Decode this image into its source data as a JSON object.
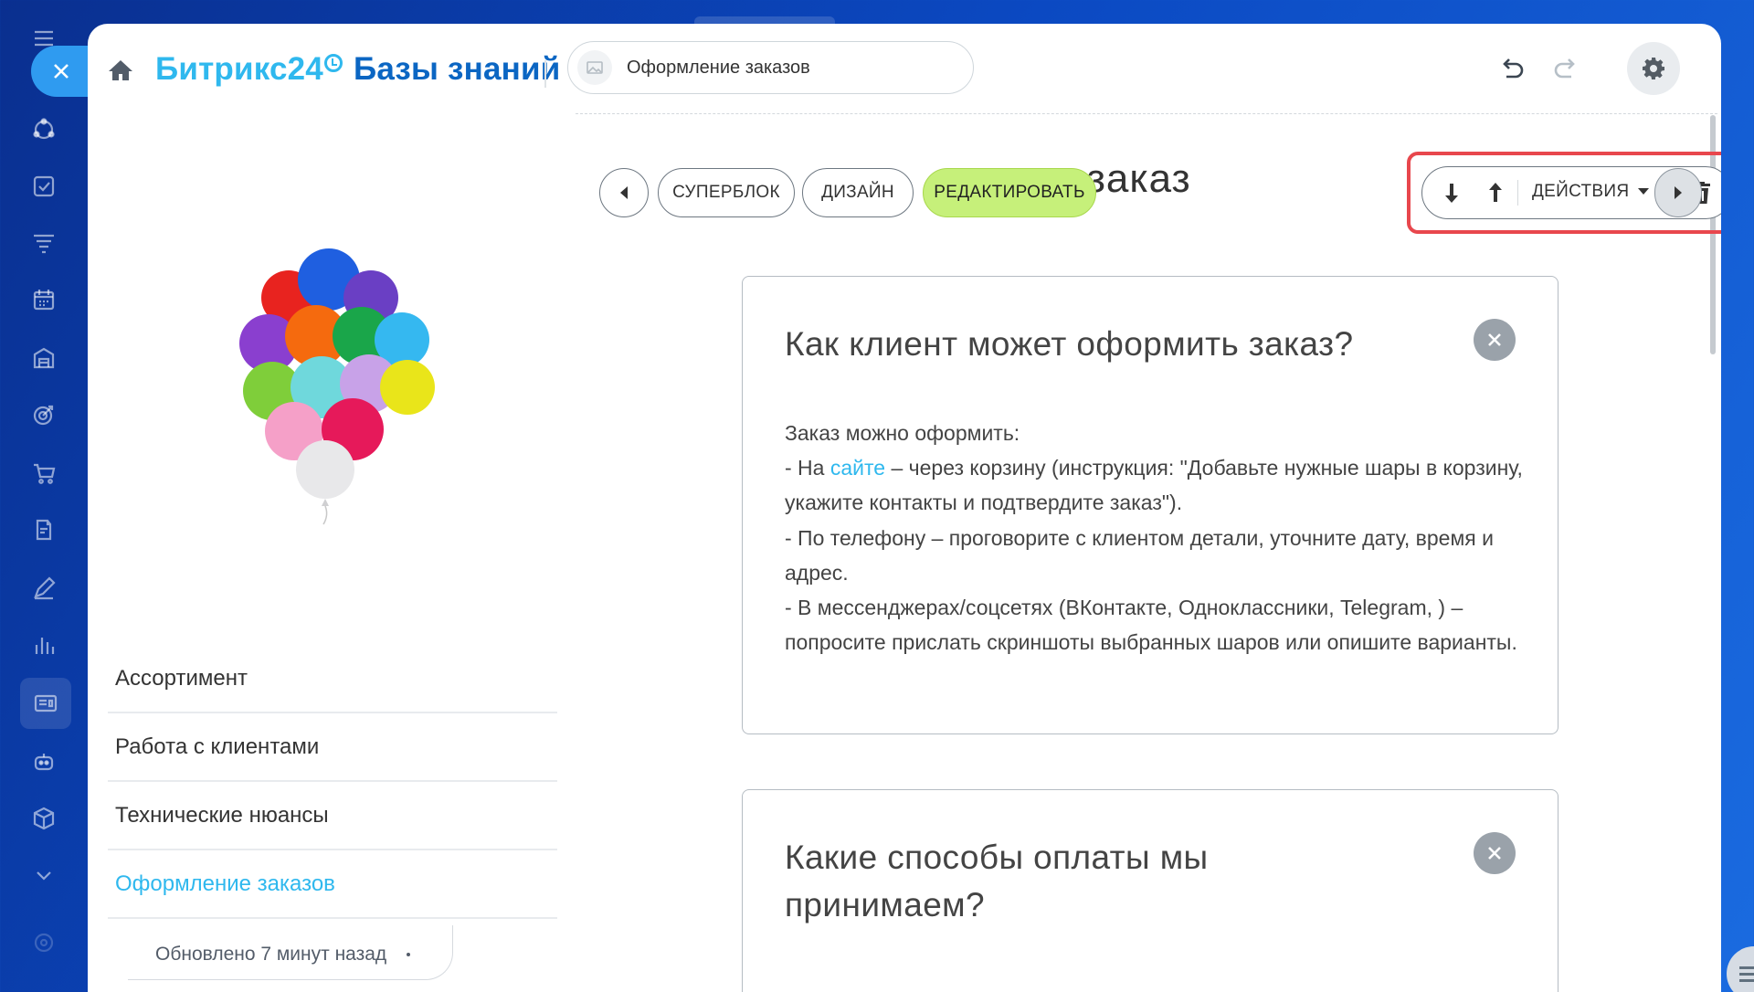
{
  "app": {
    "logo_brand": "Битрикс24",
    "logo_section": "Базы знаний",
    "current_page_chip": "Оформление заказов",
    "accent_color": "#2fb8ee",
    "edit_button_color": "#c6f07a",
    "highlight_color": "#e8474d"
  },
  "rail": {
    "icons": [
      "menu-icon",
      "close-icon",
      "feed-icon",
      "tasks-icon",
      "funnel-icon",
      "calendar-icon",
      "storage-icon",
      "target-icon",
      "cart-icon",
      "document-edit-icon",
      "pen-icon",
      "analytics-icon",
      "sites-icon",
      "robot-icon",
      "box-icon",
      "chevron-down-icon",
      "settings-icon"
    ]
  },
  "toolbar": {
    "prev": "previous-block-icon",
    "superblock": "СУПЕРБЛОК",
    "design": "ДИЗАЙН",
    "edit": "РЕДАКТИРОВАТЬ",
    "actions": "ДЕЙСТВИЯ",
    "next": "next-block-icon"
  },
  "page": {
    "heading_visible_part": "ление заказ"
  },
  "nav": {
    "items": [
      {
        "label": "Ассортимент"
      },
      {
        "label": "Работа с клиентами"
      },
      {
        "label": "Технические нюансы"
      },
      {
        "label": "Оформление заказов"
      }
    ],
    "active_index": 3,
    "updated": "Обновлено 7 минут назад"
  },
  "cards": [
    {
      "title": "Как клиент может оформить заказ?",
      "intro": "Заказ можно оформить:",
      "line1_before": "- На ",
      "line1_link": "сайте",
      "line1_after": " – через корзину (инструкция: \"Добавьте нужные шары в корзину, укажите контакты и подтвердите заказ\").",
      "line2": "- По телефону – проговорите с клиентом детали, уточните дату, время и адрес.",
      "line3": "- В мессенджерах/соцсетях (ВКонтакте, Одноклассники, Telegram, ) – попросите прислать скриншоты выбранных шаров или опишите варианты."
    },
    {
      "title": "Какие способы оплаты мы принимаем?"
    }
  ]
}
